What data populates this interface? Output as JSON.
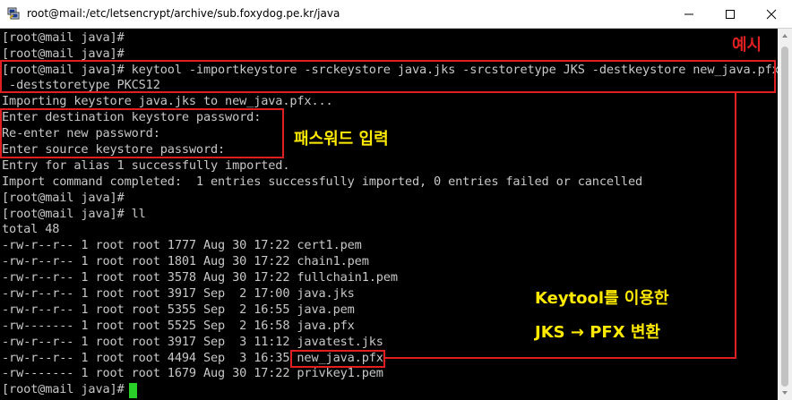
{
  "window": {
    "title": "root@mail:/etc/letsencrypt/archive/sub.foxydog.pe.kr/java",
    "icon": "putty-icon",
    "buttons": [
      "minimize",
      "maximize",
      "close"
    ]
  },
  "terminal": {
    "lines": [
      "[root@mail java]#",
      "[root@mail java]#",
      "[root@mail java]# keytool -importkeystore -srckeystore java.jks -srcstoretype JKS -destkeystore new_java.pfx",
      " -deststoretype PKCS12",
      "Importing keystore java.jks to new_java.pfx...",
      "Enter destination keystore password:",
      "Re-enter new password:",
      "Enter source keystore password:",
      "Entry for alias 1 successfully imported.",
      "Import command completed:  1 entries successfully imported, 0 entries failed or cancelled",
      "[root@mail java]#",
      "[root@mail java]# ll",
      "total 48",
      "-rw-r--r-- 1 root root 1777 Aug 30 17:22 cert1.pem",
      "-rw-r--r-- 1 root root 1801 Aug 30 17:22 chain1.pem",
      "-rw-r--r-- 1 root root 3578 Aug 30 17:22 fullchain1.pem",
      "-rw-r--r-- 1 root root 3917 Sep  2 17:00 java.jks",
      "-rw-r--r-- 1 root root 5355 Sep  2 16:55 java.pem",
      "-rw------- 1 root root 5525 Sep  2 16:58 java.pfx",
      "-rw-r--r-- 1 root root 3917 Sep  3 11:12 javatest.jks",
      "-rw-r--r-- 1 root root 4494 Sep  3 16:35 new_java.pfx",
      "-rw------- 1 root root 1679 Aug 30 17:22 privkey1.pem",
      "[root@mail java]#"
    ]
  },
  "annotations": {
    "example": "예시",
    "password_input": "패스워드 입력",
    "keytool_line1": "Keytool를 이용한",
    "keytool_line2": "JKS → PFX 변환"
  },
  "colors": {
    "terminal_bg": "#000000",
    "terminal_text": "#c8c8c8",
    "highlight_box": "#e02020",
    "annotation_red": "#e02020",
    "annotation_yellow": "#ffea00",
    "cursor": "#28d028"
  }
}
